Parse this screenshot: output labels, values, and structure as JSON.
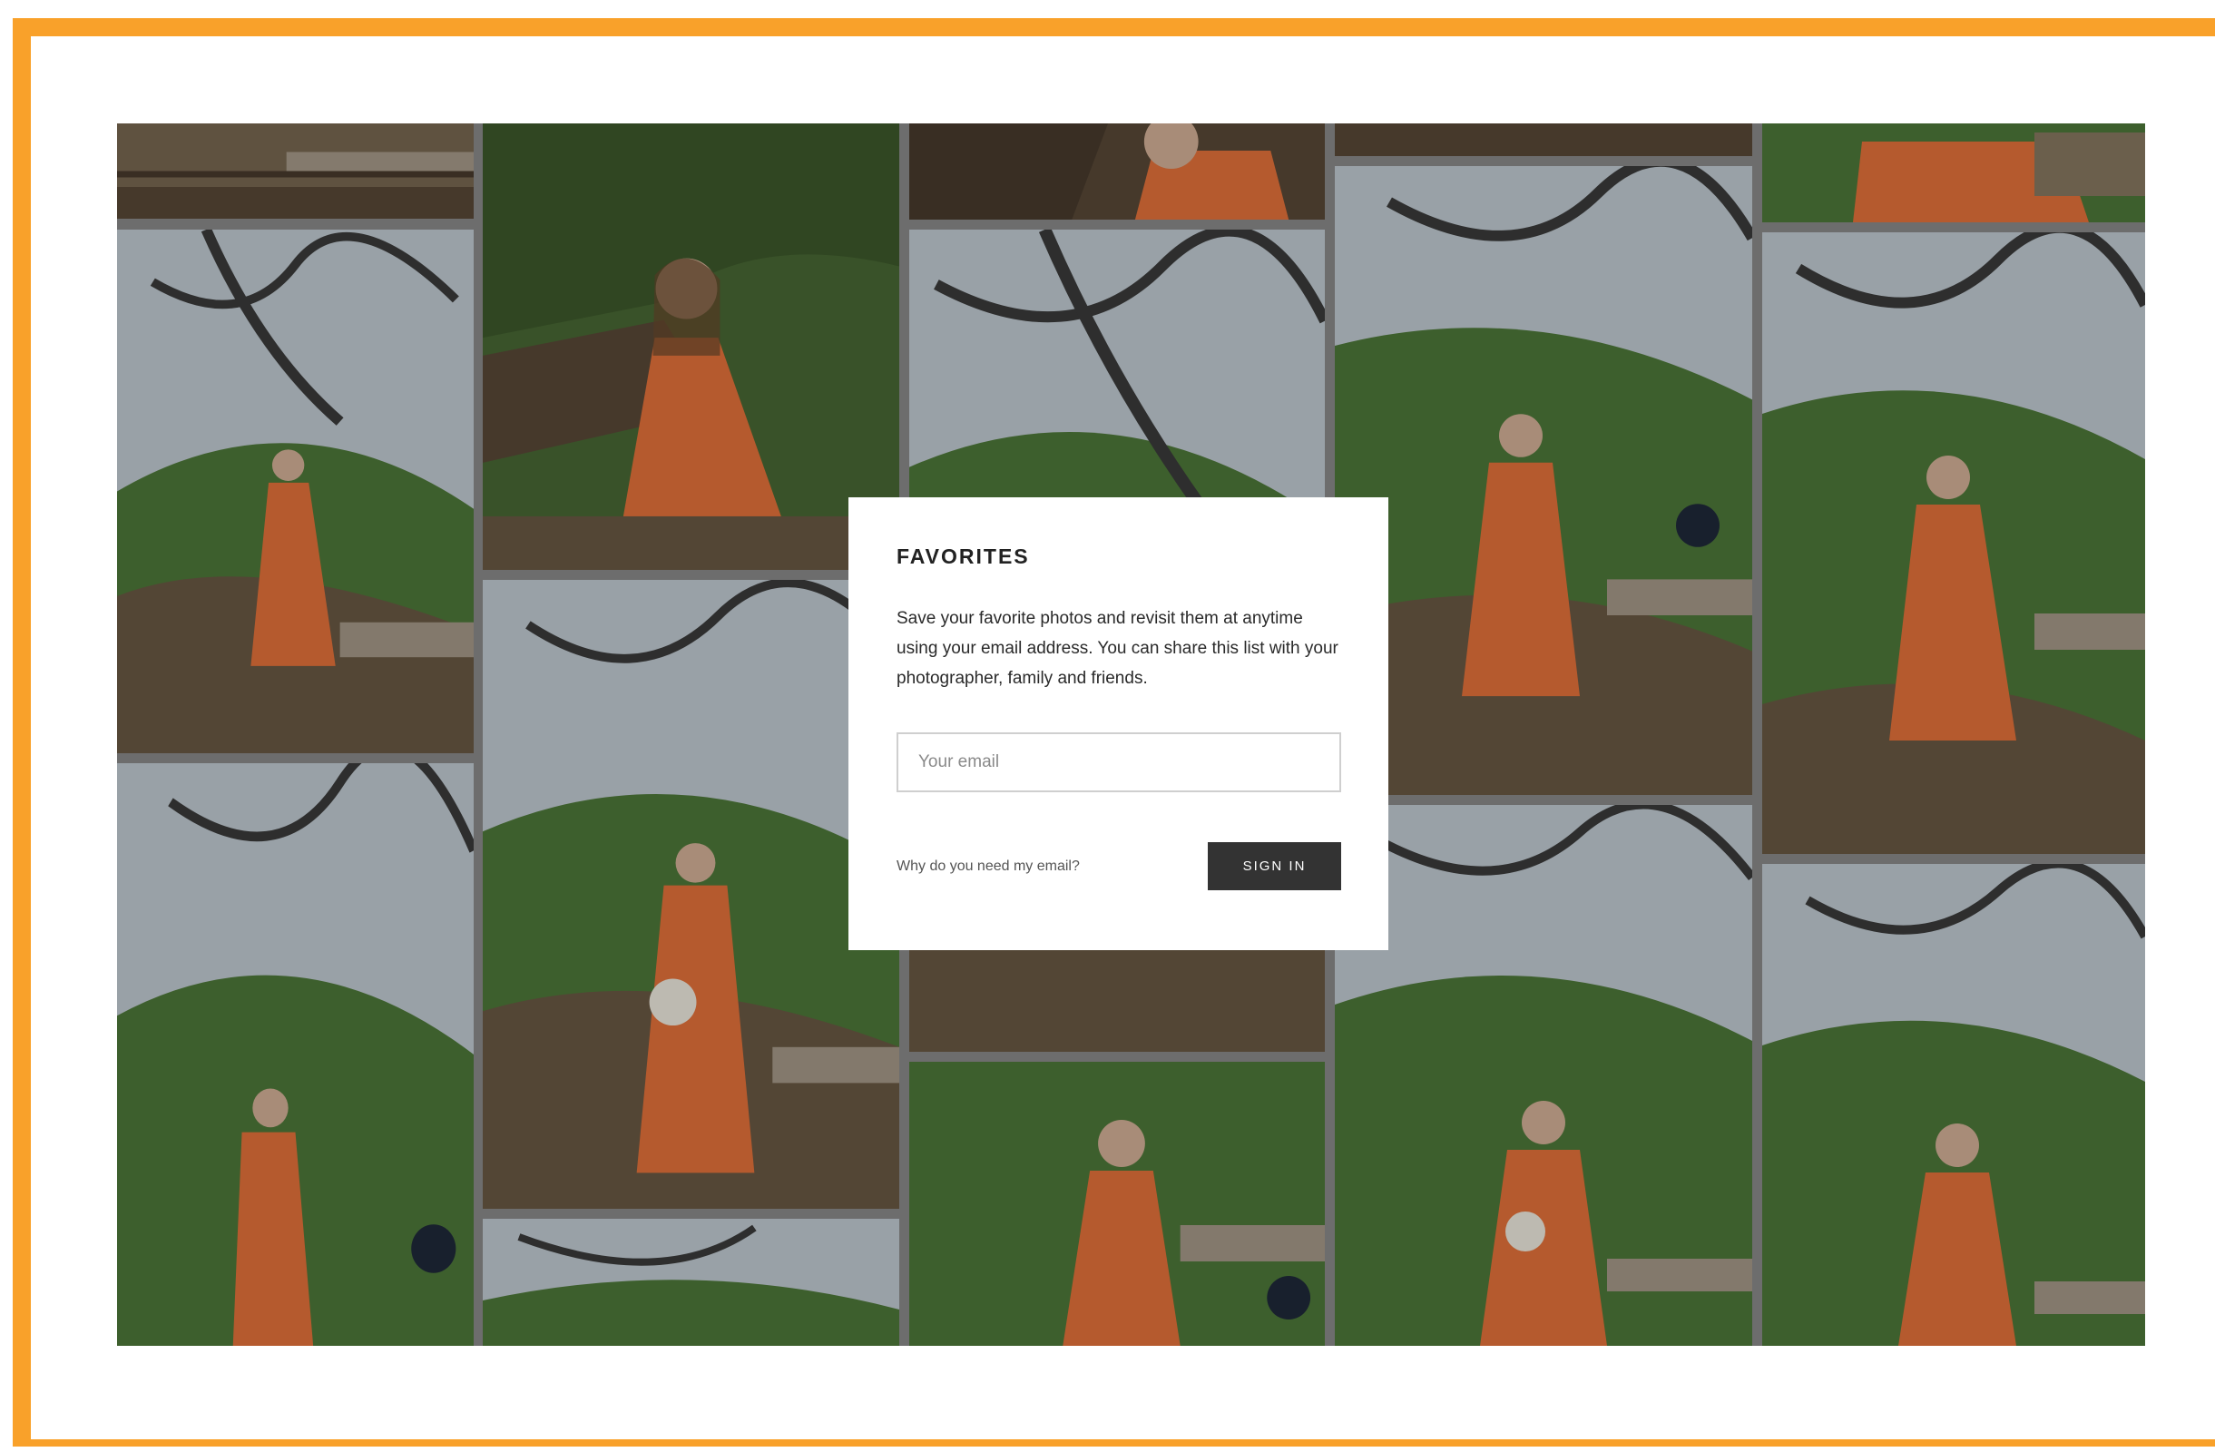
{
  "modal": {
    "title": "FAVORITES",
    "description": "Save your favorite photos and revisit them at anytime using your email address. You can share this list with your photographer, family and friends.",
    "email_placeholder": "Your email",
    "why_link": "Why do you need my email?",
    "signin_label": "SIGN IN"
  },
  "gallery": {
    "photos": [
      {
        "id": "photo-1",
        "scene": "steps-bench"
      },
      {
        "id": "photo-2",
        "scene": "woman-orange-dress-standing"
      },
      {
        "id": "photo-3",
        "scene": "woman-orange-dress-walking"
      },
      {
        "id": "photo-4",
        "scene": "woman-orange-dress-seated-portrait"
      },
      {
        "id": "photo-5",
        "scene": "woman-orange-dress-walking-flowers"
      },
      {
        "id": "photo-6",
        "scene": "tree-canopy"
      },
      {
        "id": "photo-7",
        "scene": "woman-orange-dress-seated"
      },
      {
        "id": "photo-8",
        "scene": "tree-hillside"
      },
      {
        "id": "photo-9",
        "scene": "woman-orange-dress-flowers"
      },
      {
        "id": "photo-10",
        "scene": "steps-path"
      },
      {
        "id": "photo-11",
        "scene": "woman-orange-dress-standing"
      },
      {
        "id": "photo-12",
        "scene": "woman-orange-dress-flowers"
      },
      {
        "id": "photo-13",
        "scene": "woman-orange-dress-seated"
      },
      {
        "id": "photo-14",
        "scene": "woman-orange-dress-walking"
      },
      {
        "id": "photo-15",
        "scene": "woman-orange-dress-standing"
      }
    ]
  },
  "colors": {
    "frame_border": "#F9A12A",
    "button_bg": "#333333",
    "dress": "#E8743B",
    "foliage": "#4F7A3A"
  }
}
